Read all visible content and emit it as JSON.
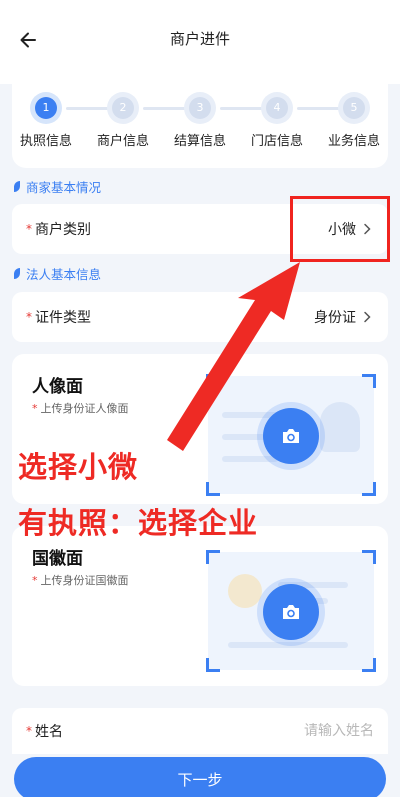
{
  "header": {
    "title": "商户进件"
  },
  "steps": [
    {
      "num": "1",
      "label": "执照信息"
    },
    {
      "num": "2",
      "label": "商户信息"
    },
    {
      "num": "3",
      "label": "结算信息"
    },
    {
      "num": "4",
      "label": "门店信息"
    },
    {
      "num": "5",
      "label": "业务信息"
    }
  ],
  "sections": {
    "merchant": {
      "title": "商家基本情况"
    },
    "legal": {
      "title": "法人基本信息"
    }
  },
  "merchant_type": {
    "required_mark": "*",
    "label": "商户类别",
    "value": "小微"
  },
  "id_type": {
    "required_mark": "*",
    "label": "证件类型",
    "value": "身份证"
  },
  "portrait_upload": {
    "title": "人像面",
    "required_mark": "*",
    "hint": "上传身份证人像面"
  },
  "emblem_upload": {
    "title": "国徽面",
    "required_mark": "*",
    "hint": "上传身份证国徽面"
  },
  "annotation": {
    "line1": "选择小微",
    "line2": "有执照：选择企业",
    "color": "#ee2a24"
  },
  "name_field": {
    "required_mark": "*",
    "label": "姓名",
    "placeholder": "请输入姓名",
    "value": ""
  },
  "footer": {
    "next_label": "下一步"
  },
  "colors": {
    "accent": "#3b7ff2",
    "required": "#e53935",
    "annotation": "#f0241f"
  }
}
